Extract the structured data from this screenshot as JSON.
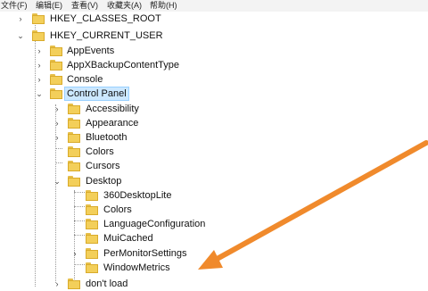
{
  "menu": [
    "文件(F)",
    "编辑(E)",
    "查看(V)",
    "收藏夹(A)",
    "帮助(H)"
  ],
  "tree": {
    "hkcr": "HKEY_CLASSES_ROOT",
    "hkcu": "HKEY_CURRENT_USER",
    "appevents": "AppEvents",
    "appx": "AppXBackupContentType",
    "console": "Console",
    "control_panel": "Control Panel",
    "accessibility": "Accessibility",
    "appearance": "Appearance",
    "bluetooth": "Bluetooth",
    "colors": "Colors",
    "cursors": "Cursors",
    "desktop": "Desktop",
    "d_360": "360DesktopLite",
    "d_colors": "Colors",
    "d_langconfig": "LanguageConfiguration",
    "d_muicached": "MuiCached",
    "d_permonitor": "PerMonitorSettings",
    "d_windowmetrics": "WindowMetrics",
    "dontload": "don't load"
  },
  "toggles": {
    "collapsed": "›",
    "expanded": "⌄"
  },
  "colors": {
    "arrow": "#f08a2c",
    "selection": "#cce8ff",
    "folder": "#f3cf5a"
  }
}
